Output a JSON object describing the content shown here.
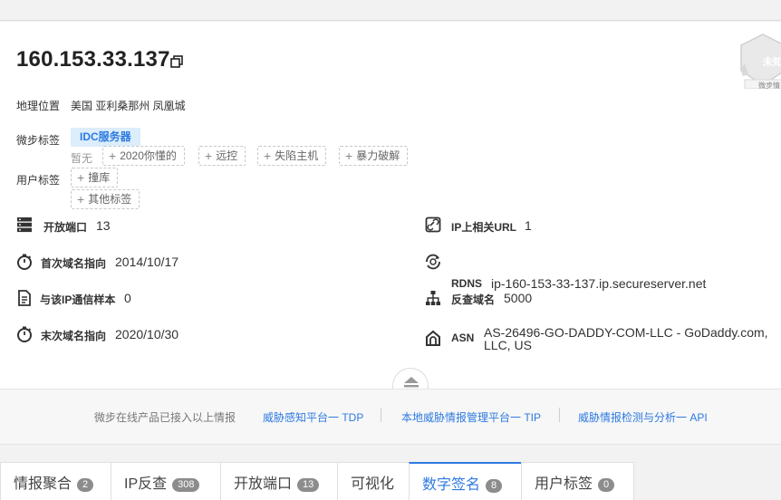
{
  "header": {
    "ip": "160.153.33.137"
  },
  "badge": {
    "line1": "未知",
    "line2": "微步情"
  },
  "geo": {
    "label": "地理位置",
    "value": "美国 亚利桑那州 凤凰城"
  },
  "weibu_tags": {
    "label": "微步标签",
    "tag": "IDC服务器"
  },
  "user_tags": {
    "label": "用户标签",
    "none_text": "暂无",
    "suggestions": [
      "2020你懂的",
      "远控",
      "失陷主机",
      "暴力破解",
      "撞库",
      "其他标签"
    ]
  },
  "stats": {
    "open_ports": {
      "label": "开放端口",
      "value": "13"
    },
    "first_domain": {
      "label": "首次域名指向",
      "value": "2014/10/17"
    },
    "samples": {
      "label": "与该IP通信样本",
      "value": "0"
    },
    "last_domain": {
      "label": "末次域名指向",
      "value": "2020/10/30"
    },
    "ip_urls": {
      "label": "IP上相关URL",
      "value": "1"
    },
    "rdns": {
      "label": "RDNS",
      "value": "ip-160-153-33-137.ip.secureserver.net"
    },
    "reverse_domains": {
      "label": "反查域名",
      "value": "5000"
    },
    "asn": {
      "label": "ASN",
      "value_line1": "AS-26496-GO-DADDY-COM-LLC - GoDaddy.com,",
      "value_line2": "LLC, US"
    }
  },
  "banner": {
    "intro": "微步在线产品已接入以上情报",
    "links": [
      "威胁感知平台一 TDP",
      "本地威胁情报管理平台一 TIP",
      "威胁情报检测与分析一 API"
    ]
  },
  "tabs": [
    {
      "label": "情报聚合",
      "count": "2"
    },
    {
      "label": "IP反查",
      "count": "308"
    },
    {
      "label": "开放端口",
      "count": "13"
    },
    {
      "label": "可视化",
      "count": ""
    },
    {
      "label": "数字签名",
      "count": "8"
    },
    {
      "label": "用户标签",
      "count": "0"
    }
  ],
  "active_tab": "数字签名",
  "colors": {
    "accent": "#2d7ae0",
    "tag_bg": "#dcedfb"
  }
}
